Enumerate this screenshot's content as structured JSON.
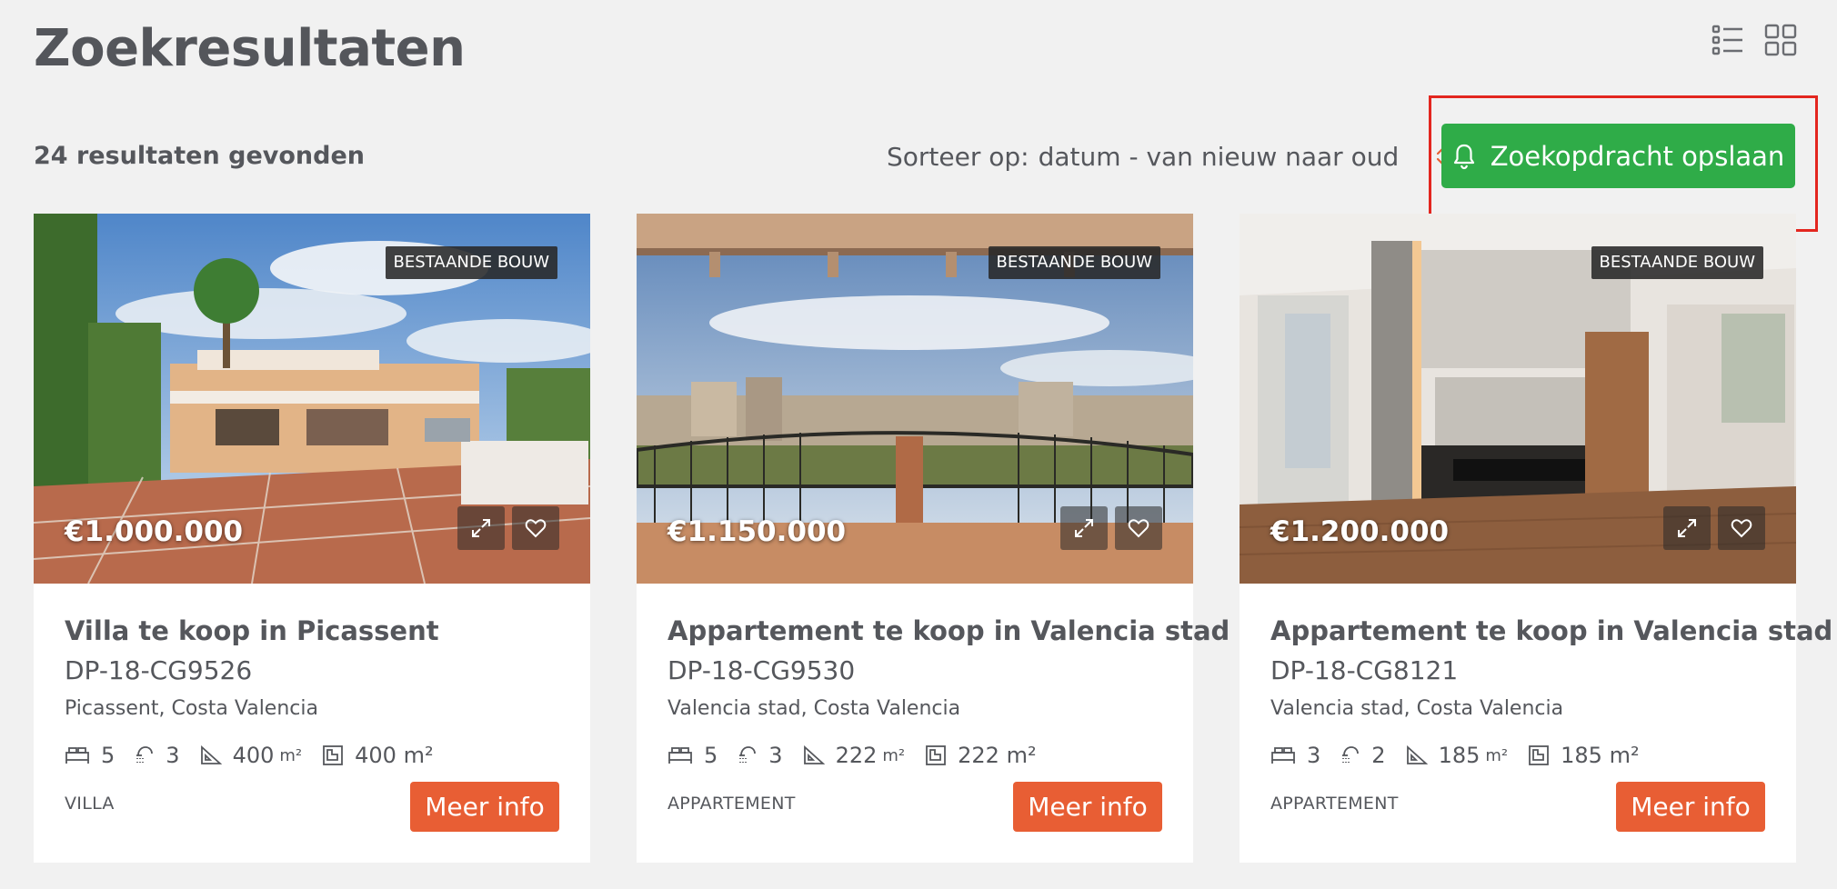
{
  "header": {
    "title": "Zoekresultaten",
    "view_icons": [
      "list-view-icon",
      "grid-view-icon"
    ]
  },
  "toolbar": {
    "results_count": "24 resultaten gevonden",
    "sort_label": "Sorteer op:",
    "sort_value": "datum - van nieuw naar oud",
    "save_search_label": "Zoekopdracht opslaan"
  },
  "colors": {
    "save_button": "#2fac48",
    "more_info_button": "#e85e34",
    "highlight": "#e3261f",
    "background": "#f1f1f1"
  },
  "listings": [
    {
      "badge": "BESTAANDE BOUW",
      "price": "€1.000.000",
      "title": "Villa te koop in Picassent",
      "ref": "DP-18-CG9526",
      "location": "Picassent, Costa Valencia",
      "bedrooms": "5",
      "bathrooms": "3",
      "built_area": "400",
      "built_unit": "m²",
      "plot_area": "400 m²",
      "type": "VILLA",
      "more_label": "Meer info"
    },
    {
      "badge": "BESTAANDE BOUW",
      "price": "€1.150.000",
      "title": "Appartement te koop in Valencia stad",
      "ref": "DP-18-CG9530",
      "location": "Valencia stad, Costa Valencia",
      "bedrooms": "5",
      "bathrooms": "3",
      "built_area": "222",
      "built_unit": "m²",
      "plot_area": "222 m²",
      "type": "APPARTEMENT",
      "more_label": "Meer info"
    },
    {
      "badge": "BESTAANDE BOUW",
      "price": "€1.200.000",
      "title": "Appartement te koop in Valencia stad",
      "ref": "DP-18-CG8121",
      "location": "Valencia stad, Costa Valencia",
      "bedrooms": "3",
      "bathrooms": "2",
      "built_area": "185",
      "built_unit": "m²",
      "plot_area": "185 m²",
      "type": "APPARTEMENT",
      "more_label": "Meer info"
    }
  ]
}
